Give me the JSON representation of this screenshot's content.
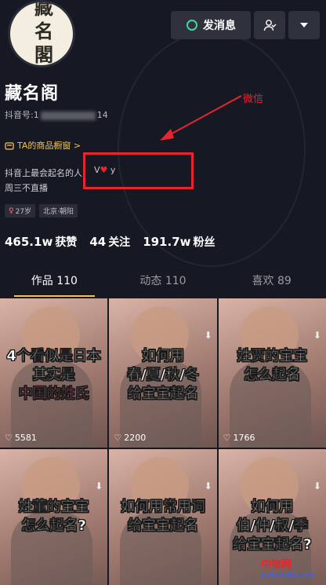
{
  "header": {
    "avatar_text": [
      "藏",
      "名",
      "閣"
    ],
    "message_button": "发消息"
  },
  "profile": {
    "name": "藏名阁",
    "uid_label": "抖音号:",
    "uid_prefix": "1",
    "uid_suffix": "14",
    "shop_link": "TA的商品橱窗 >",
    "bio_line1": "抖音上最会起名的人",
    "bio_contact": "V",
    "bio_contact_tail": "y",
    "bio_line2": "周三不直播",
    "tags": [
      "27岁",
      "北京·朝阳"
    ]
  },
  "stats": [
    {
      "value": "465.1w",
      "label": "获赞"
    },
    {
      "value": "44",
      "label": "关注"
    },
    {
      "value": "191.7w",
      "label": "粉丝"
    }
  ],
  "tabs": [
    "作品 110",
    "动态 110",
    "喜欢 89"
  ],
  "videos": [
    {
      "caption": [
        "4个看似是日本",
        "其实是",
        "中国的姓氏"
      ],
      "likes": "5581"
    },
    {
      "caption": [
        "如何用",
        "春/夏/秋/冬",
        "给宝宝起名"
      ],
      "likes": "2200"
    },
    {
      "caption": [
        "姓贾的宝宝",
        "怎么起名"
      ],
      "likes": "1766"
    },
    {
      "caption": [
        "姓董的宝宝",
        "怎么起名?"
      ],
      "likes": ""
    },
    {
      "caption": [
        "如何用常用词",
        "给宝宝起名"
      ],
      "likes": ""
    },
    {
      "caption": [
        "如何用",
        "伯/仲/叔/季",
        "给宝宝起名?"
      ],
      "likes": ""
    }
  ],
  "annotation": {
    "label": "微信",
    "color": "#e8242f"
  },
  "watermark": {
    "corner_text": "中物网",
    "corner_url": "www.wz88.com"
  },
  "colors": {
    "background": "#161823",
    "accent": "#f5c447",
    "button": "#2f313c"
  }
}
